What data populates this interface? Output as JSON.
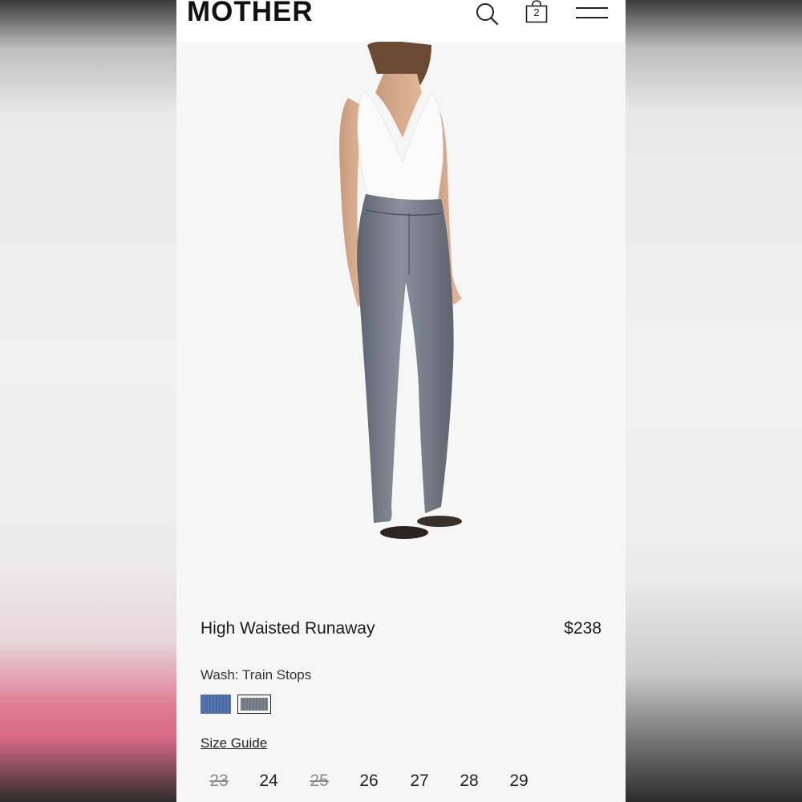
{
  "brand": "MOTHER",
  "header": {
    "cart_count": "2"
  },
  "product": {
    "image_alt": "Model wearing grey high waisted bootcut jeans and white v-neck top",
    "title": "High Waisted Runaway",
    "price": "$238",
    "wash_label": "Wash: Train Stops",
    "swatches": [
      {
        "name": "blue-wash",
        "color": "#5270a8",
        "selected": false
      },
      {
        "name": "train-stops",
        "color": "#757b85",
        "selected": true
      }
    ],
    "size_guide": "Size Guide",
    "sizes": [
      {
        "label": "23",
        "available": false
      },
      {
        "label": "24",
        "available": true
      },
      {
        "label": "25",
        "available": false
      },
      {
        "label": "26",
        "available": true
      },
      {
        "label": "27",
        "available": true
      },
      {
        "label": "28",
        "available": true
      },
      {
        "label": "29",
        "available": true
      }
    ]
  },
  "colors": {
    "background": "#f6f6f6",
    "text": "#1c1c1c",
    "denim_grey": "#757b85",
    "denim_blue": "#5270a8"
  }
}
